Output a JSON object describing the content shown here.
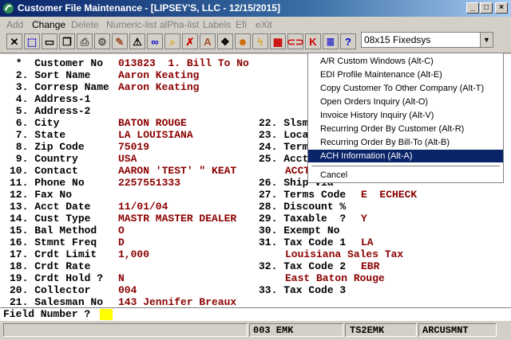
{
  "window": {
    "title": "Customer File Maintenance - [LIPSEY'S, LLC - 12/15/2015]"
  },
  "menu": [
    {
      "label": "Add",
      "enabled": false
    },
    {
      "label": "Change",
      "enabled": true
    },
    {
      "label": "Delete",
      "enabled": false
    },
    {
      "label": "Numeric-list",
      "enabled": false
    },
    {
      "label": "alPha-list",
      "enabled": false
    },
    {
      "label": "Labels",
      "enabled": false
    },
    {
      "label": "Efi",
      "enabled": false
    },
    {
      "label": "eXit",
      "enabled": false
    }
  ],
  "toolbar": {
    "font_select": "08x15 Fixedsys"
  },
  "fields_left": [
    {
      "label": " *  Customer No",
      "value": "013823  1. Bill To No"
    },
    {
      "label": " 2. Sort Name",
      "value": "Aaron Keating"
    },
    {
      "label": " 3. Corresp Name",
      "value": "Aaron Keating"
    },
    {
      "label": " 4. Address-1",
      "value": ""
    },
    {
      "label": " 5. Address-2",
      "value": ""
    },
    {
      "label": " 6. City",
      "value": "BATON ROUGE"
    },
    {
      "label": " 7. State",
      "value": "LA LOUISIANA"
    },
    {
      "label": " 8. Zip Code",
      "value": "75019"
    },
    {
      "label": " 9. Country",
      "value": "USA"
    },
    {
      "label": "10. Contact",
      "value": "AARON 'TEST' \" KEAT"
    },
    {
      "label": "11. Phone No",
      "value": "2257551333"
    },
    {
      "label": "12. Fax No",
      "value": ""
    },
    {
      "label": "13. Acct Date",
      "value": "11/01/04"
    },
    {
      "label": "14. Cust Type",
      "value": "MASTR MASTER DEALER"
    },
    {
      "label": "15. Bal Method",
      "value": "O"
    },
    {
      "label": "16. Stmnt Freq",
      "value": "D"
    },
    {
      "label": "17. Crdt Limit",
      "value": "1,000"
    },
    {
      "label": "18. Crdt Rate",
      "value": ""
    },
    {
      "label": "19. Crdt Hold ?",
      "value": "N"
    },
    {
      "label": "20. Collector",
      "value": "004"
    },
    {
      "label": "21. Salesman No",
      "value": "143 Jennifer Breaux"
    }
  ],
  "fields_right": [
    {
      "row": 5,
      "label": "22. Slsm",
      "value": ""
    },
    {
      "row": 6,
      "label": "23. Loca",
      "value": ""
    },
    {
      "row": 7,
      "label": "24. Term",
      "value": ""
    },
    {
      "row": 8,
      "label": "25. Acct",
      "value": ""
    },
    {
      "row": 9,
      "label": "",
      "value": "ACCT"
    },
    {
      "row": 10,
      "label": "26. Ship Via",
      "value": ""
    },
    {
      "row": 11,
      "label": "27. Terms Code",
      "value": "E  ECHECK"
    },
    {
      "row": 12,
      "label": "28. Discount %",
      "value": ""
    },
    {
      "row": 13,
      "label": "29. Taxable  ?",
      "value": "Y"
    },
    {
      "row": 14,
      "label": "30. Exempt No",
      "value": ""
    },
    {
      "row": 15,
      "label": "31. Tax Code 1",
      "value": "LA"
    },
    {
      "row": 16,
      "label": "",
      "value": "Louisiana Sales Tax"
    },
    {
      "row": 17,
      "label": "32. Tax Code 2",
      "value": "EBR"
    },
    {
      "row": 18,
      "label": "",
      "value": "East Baton Rouge"
    },
    {
      "row": 19,
      "label": "33. Tax Code 3",
      "value": ""
    }
  ],
  "popup_menu": [
    "A/R Custom Windows (Alt-C)",
    "EDI Profile Maintenance (Alt-E)",
    "Copy Customer To Other Company (Alt-T)",
    "Open Orders Inquiry (Alt-O)",
    "Invoice History Inquiry (Alt-V)",
    "Recurring Order By Customer (Alt-R)",
    "Recurring Order By Bill-To (Alt-B)",
    "ACH Information (Alt-A)",
    "Cancel"
  ],
  "prompt": {
    "label": "Field Number ?"
  },
  "status": {
    "company": "003 EMK",
    "user": "TS2EMK",
    "program": "ARCUSMNT"
  }
}
